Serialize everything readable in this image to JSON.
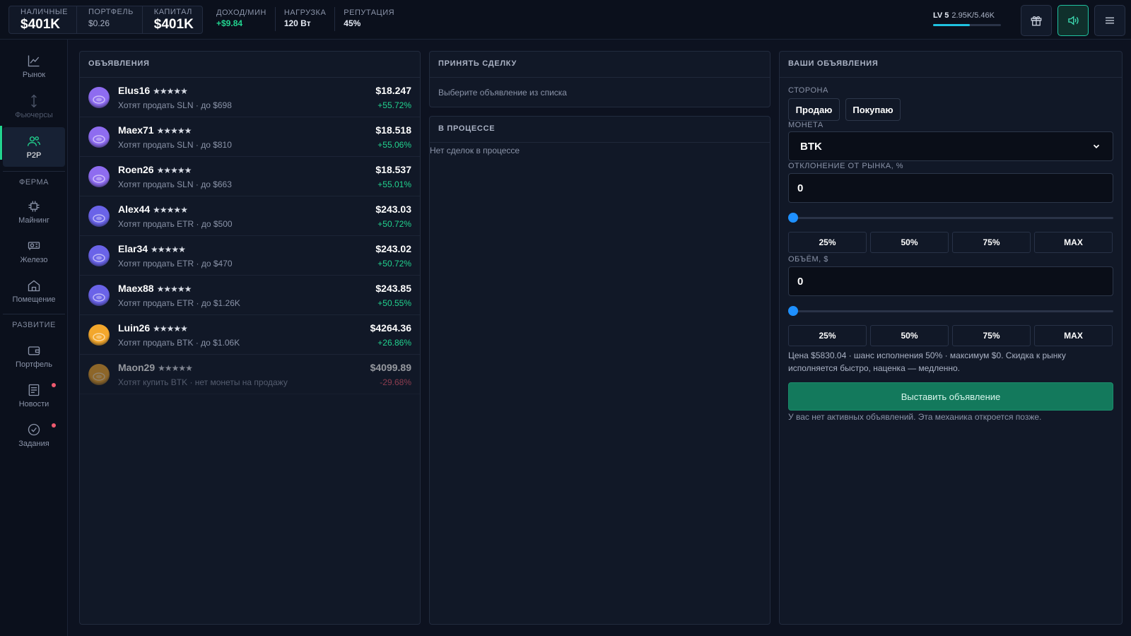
{
  "header": {
    "cash_label": "НАЛИЧНЫЕ",
    "cash_value": "$401K",
    "portfolio_label": "ПОРТФЕЛЬ",
    "portfolio_value": "$0.26",
    "capital_label": "КАПИТАЛ",
    "capital_value": "$401K",
    "income_label": "ДОХОД/МИН",
    "income_value": "+$9.84",
    "load_label": "НАГРУЗКА",
    "load_value": "120 Вт",
    "reputation_label": "РЕПУТАЦИЯ",
    "reputation_value": "45%",
    "level_label": "LV 5",
    "level_xp": "2.95K/5.46K",
    "level_progress": 0.54,
    "icons": [
      "gift-icon",
      "sound-icon",
      "menu-icon"
    ]
  },
  "sidebar": {
    "market": "Рынок",
    "futures": "Фьючерсы",
    "p2p": "P2P",
    "farm_section": "ФЕРМА",
    "mining": "Майнинг",
    "hardware": "Железо",
    "room": "Помещение",
    "dev_section": "РАЗВИТИЕ",
    "portfolio": "Портфель",
    "news": "Новости",
    "tasks": "Задания"
  },
  "listings": {
    "title": "ОБЪЯВЛЕНИЯ",
    "rows": [
      {
        "name": "Elus16",
        "stars": "★★★★★",
        "desc": "Хотят продать SLN · до $698",
        "price": "$18.247",
        "change": "+55.72%",
        "coin": "SLN",
        "color": "#8e6cf0"
      },
      {
        "name": "Maex71",
        "stars": "★★★★★",
        "desc": "Хотят продать SLN · до $810",
        "price": "$18.518",
        "change": "+55.06%",
        "coin": "SLN",
        "color": "#8e6cf0"
      },
      {
        "name": "Roen26",
        "stars": "★★★★★",
        "desc": "Хотят продать SLN · до $663",
        "price": "$18.537",
        "change": "+55.01%",
        "coin": "SLN",
        "color": "#8e6cf0"
      },
      {
        "name": "Alex44",
        "stars": "★★★★★",
        "desc": "Хотят продать ETR · до $500",
        "price": "$243.03",
        "change": "+50.72%",
        "coin": "ETR",
        "color": "#6a63e8"
      },
      {
        "name": "Elar34",
        "stars": "★★★★★",
        "desc": "Хотят продать ETR · до $470",
        "price": "$243.02",
        "change": "+50.72%",
        "coin": "ETR",
        "color": "#6a63e8"
      },
      {
        "name": "Maex88",
        "stars": "★★★★★",
        "desc": "Хотят продать ETR · до $1.26K",
        "price": "$243.85",
        "change": "+50.55%",
        "coin": "ETR",
        "color": "#6a63e8"
      },
      {
        "name": "Luin26",
        "stars": "★★★★★",
        "desc": "Хотят продать BTK · до $1.06K",
        "price": "$4264.36",
        "change": "+26.86%",
        "coin": "BTK",
        "color": "#f3a72c"
      },
      {
        "name": "Maon29",
        "stars": "★★★★★",
        "desc": "Хотят купить BTK · нет монеты на продажу",
        "price": "$4099.89",
        "change": "-29.68%",
        "coin": "BTK",
        "color": "#f3a72c"
      }
    ]
  },
  "accept": {
    "title": "ПРИНЯТЬ СДЕЛКУ",
    "hint": "Выберите объявление из списка"
  },
  "progress": {
    "title": "В ПРОЦЕССЕ",
    "empty": "Нет сделок в процессе"
  },
  "my_ads": {
    "title": "ВАШИ ОБЪЯВЛЕНИЯ",
    "side_label": "СТОРОНА",
    "sell": "Продаю",
    "buy": "Покупаю",
    "coin_label": "МОНЕТА",
    "coin_value": "BTK",
    "deviation_label": "ОТКЛОНЕНИЕ ОТ РЫНКА, %",
    "deviation_value": "0",
    "deviation_slider": 0,
    "volume_label": "ОБЪЁМ, $",
    "volume_value": "0",
    "volume_slider": 0,
    "presets": [
      "25%",
      "50%",
      "75%",
      "MAX"
    ],
    "price_note": "Цена $5830.04 · шанс исполнения 50% · максимум $0. Скидка к рынку исполняется быстро, наценка — медленно.",
    "submit": "Выставить объявление",
    "footer_note": "У вас нет активных объявлений. Эта механика откроется позже."
  }
}
